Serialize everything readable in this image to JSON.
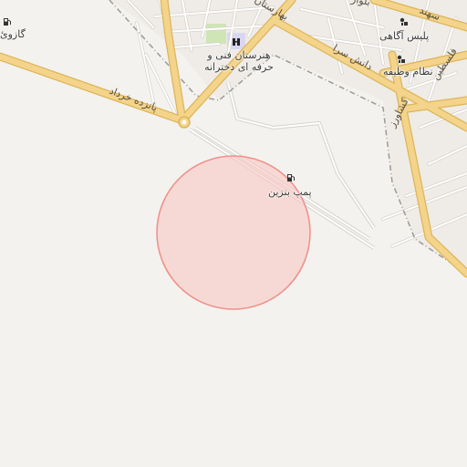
{
  "map": {
    "colors": {
      "land": "#f4f2ee",
      "major_road": "#f4d48a",
      "major_road_casing": "#dcb55a",
      "minor_road": "#ffffff",
      "minor_road_casing": "#d6d2cc",
      "boundary": "#9a9a9a",
      "park": "#cfe5b5",
      "school": "#d9d6f0",
      "highlight_fill": "#f7c9c6",
      "highlight_stroke": "#ef8f8a"
    },
    "labels": {
      "poi_gas_station_west": "گازوئ",
      "poi_gas_station": "پمپ بنزین",
      "poi_school": "هنرستان فنی و حرفه ای دخترانه",
      "poi_police": "پلیس آگاهی",
      "poi_police_traffic": "نظام وظیفه",
      "road_panzdah_khordad": "پانزده خرداد",
      "road_bahrestan": "بهارستان",
      "road_danesh_sara": "دانش سرا",
      "road_keshavarz": "کشاورز",
      "road_felestin": "فلسطین",
      "road_boulevard": "بلوار",
      "road_sahand": "سهند"
    },
    "icons": [
      "gas-station-icon",
      "school-icon",
      "police-icon"
    ]
  }
}
